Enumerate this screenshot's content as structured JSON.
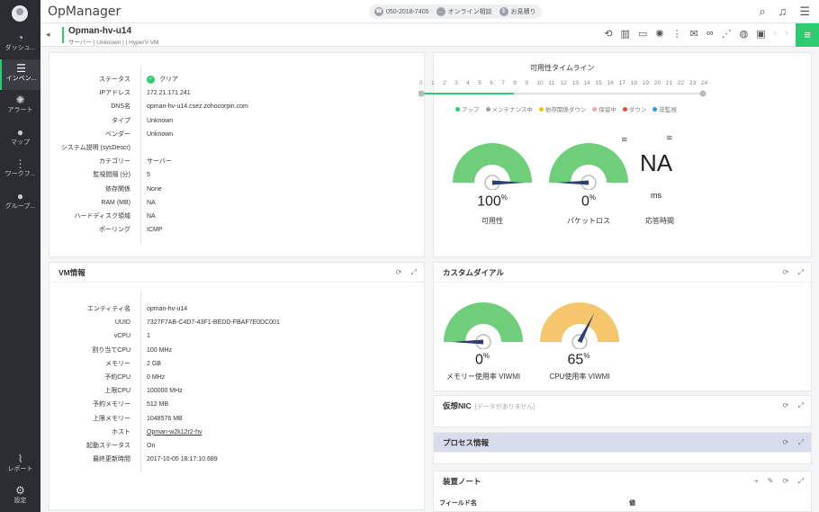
{
  "app": {
    "title": "OpManager"
  },
  "sidebar": {
    "items": [
      {
        "label": "ダッシュ...",
        "icon": "gauge-icon"
      },
      {
        "label": "インベン...",
        "icon": "inventory-icon",
        "active": true
      },
      {
        "label": "アラート",
        "icon": "alarm-icon"
      },
      {
        "label": "マップ",
        "icon": "map-pin-icon"
      },
      {
        "label": "ワークフ...",
        "icon": "workflow-icon"
      },
      {
        "label": "グループ...",
        "icon": "chat-icon"
      },
      {
        "label": "レポート",
        "icon": "report-icon"
      },
      {
        "label": "設定",
        "icon": "gear-icon"
      }
    ]
  },
  "topbar": {
    "phone": "050-2018-7405",
    "consult": "オンライン相談",
    "quote": "お見積り"
  },
  "device": {
    "name": "Opman-hv-u14",
    "subtitle": "サーバー | Unknown |  | HyperV-VM"
  },
  "summary": {
    "rows": [
      {
        "key": "ステータス",
        "value": "クリア"
      },
      {
        "key": "IPアドレス",
        "value": "172.21.171.241"
      },
      {
        "key": "DNS名",
        "value": "opman-hv-u14.csez.zohocorpin.com"
      },
      {
        "key": "タイプ",
        "value": "Unknown"
      },
      {
        "key": "ベンダー",
        "value": "Unknown"
      },
      {
        "key": "システム説明 (sysDescr)",
        "value": ""
      },
      {
        "key": "カテゴリー",
        "value": "サーバー"
      },
      {
        "key": "監視間隔 (分)",
        "value": "5"
      },
      {
        "key": "依存関係",
        "value": "None"
      },
      {
        "key": "RAM (MB)",
        "value": "NA"
      },
      {
        "key": "ハードディスク領域",
        "value": "NA"
      },
      {
        "key": "ポーリング",
        "value": "ICMP"
      }
    ]
  },
  "timeline": {
    "title": "可用性タイムライン",
    "hours": [
      "0",
      "1",
      "2",
      "3",
      "4",
      "5",
      "6",
      "7",
      "8",
      "9",
      "10",
      "11",
      "12",
      "13",
      "14",
      "15",
      "16",
      "17",
      "18",
      "19",
      "20",
      "21",
      "22",
      "23",
      "24"
    ],
    "up_fraction": 0.33,
    "legend": [
      {
        "label": "アップ",
        "color": "#2ecc71"
      },
      {
        "label": "メンテナンス中",
        "color": "#9aa0a6"
      },
      {
        "label": "依存関係ダウン",
        "color": "#f1c40f"
      },
      {
        "label": "保留中",
        "color": "#f5a3b0"
      },
      {
        "label": "ダウン",
        "color": "#e74c3c"
      },
      {
        "label": "非監視",
        "color": "#3498db"
      }
    ]
  },
  "gauges": {
    "availability": {
      "value": "100",
      "unit": "%",
      "label": "可用性",
      "percent": 100,
      "color": "#6fce7a"
    },
    "packet_loss": {
      "value": "0",
      "unit": "%",
      "label": "パケットロス",
      "percent": 0,
      "color": "#6fce7a"
    },
    "response": {
      "value": "NA",
      "unit": "ms",
      "label": "応答時間"
    }
  },
  "vm_info": {
    "title": "VM情報",
    "rows": [
      {
        "key": "エンティティ名",
        "value": "opman-hv-u14"
      },
      {
        "key": "UUID",
        "value": "7327F7AB-C4D7-43F1-BEDD-FBAF7E0DC001"
      },
      {
        "key": "vCPU",
        "value": "1"
      },
      {
        "key": "割り当てCPU",
        "value": "100 MHz"
      },
      {
        "key": "メモリー",
        "value": "2 GB"
      },
      {
        "key": "予約CPU",
        "value": "0 MHz"
      },
      {
        "key": "上限CPU",
        "value": "100000 MHz"
      },
      {
        "key": "予約メモリー",
        "value": "512 MB"
      },
      {
        "key": "上限メモリー",
        "value": "1048576 MB"
      },
      {
        "key": "ホスト",
        "value": "Opman-w2k12r2-hv"
      },
      {
        "key": "起動ステータス",
        "value": "On"
      },
      {
        "key": "最終更新時間",
        "value": "2017-10-05 18:17:10.689"
      }
    ]
  },
  "custom_dials": {
    "title": "カスタムダイアル",
    "memory": {
      "value": "0",
      "unit": "%",
      "label": "メモリー使用率 VIWMI",
      "percent": 0,
      "color": "#6fce7a"
    },
    "cpu": {
      "value": "65",
      "unit": "%",
      "label": "CPU使用率 VIWMI",
      "percent": 65,
      "color": "#f5c66b"
    }
  },
  "virtual_nic": {
    "title": "仮想NIC",
    "hint": "[データがありません]"
  },
  "process_info": {
    "title": "プロセス情報"
  },
  "device_notes": {
    "title": "装置ノート",
    "col1": "フィールド名",
    "col2": "値"
  }
}
